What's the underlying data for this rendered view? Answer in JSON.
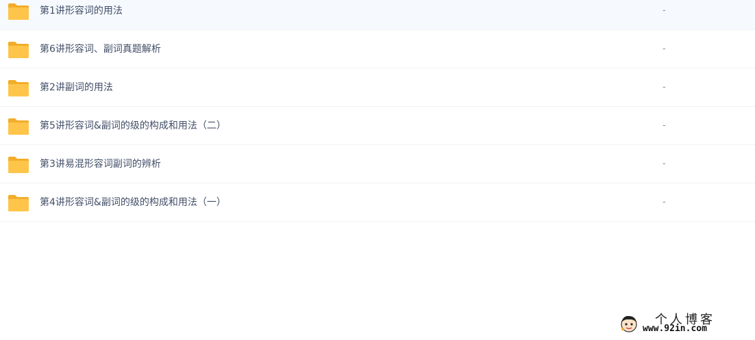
{
  "files": [
    {
      "name": "第1讲形容词的用法",
      "size": "-"
    },
    {
      "name": "第6讲形容词、副词真题解析",
      "size": "-"
    },
    {
      "name": "第2讲副词的用法",
      "size": "-"
    },
    {
      "name": "第5讲形容词&副词的级的构成和用法（二）",
      "size": "-"
    },
    {
      "name": "第3讲易混形容词副词的辨析",
      "size": "-"
    },
    {
      "name": "第4讲形容词&副词的级的构成和用法（一）",
      "size": "-"
    }
  ],
  "folder_icon": "folder-icon",
  "colors": {
    "folder": "#ffc54a",
    "folder_dark": "#f2ad2a",
    "text": "#424e67",
    "divider": "#f1f2f4"
  },
  "watermark": {
    "title": "个人博客",
    "url": "www.92in.com"
  }
}
